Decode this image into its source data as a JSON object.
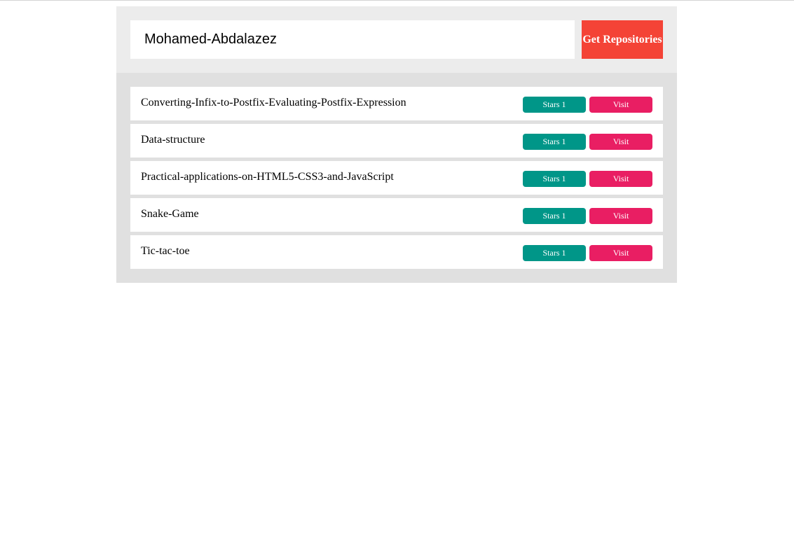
{
  "search": {
    "value": "Mohamed-Abdalazez",
    "button_label": "Get Repositories"
  },
  "colors": {
    "button": "#f44336",
    "stars": "#009688",
    "visit": "#e91e63",
    "search_bg": "#ececec",
    "list_bg": "#e0e0e0"
  },
  "repositories": [
    {
      "name": "Converting-Infix-to-Postfix-Evaluating-Postfix-Expression",
      "stars_label": "Stars",
      "stars": "1",
      "visit_label": "Visit"
    },
    {
      "name": "Data-structure",
      "stars_label": "Stars",
      "stars": "1",
      "visit_label": "Visit"
    },
    {
      "name": "Practical-applications-on-HTML5-CSS3-and-JavaScript",
      "stars_label": "Stars",
      "stars": "1",
      "visit_label": "Visit"
    },
    {
      "name": "Snake-Game",
      "stars_label": "Stars",
      "stars": "1",
      "visit_label": "Visit"
    },
    {
      "name": "Tic-tac-toe",
      "stars_label": "Stars",
      "stars": "1",
      "visit_label": "Visit"
    }
  ]
}
